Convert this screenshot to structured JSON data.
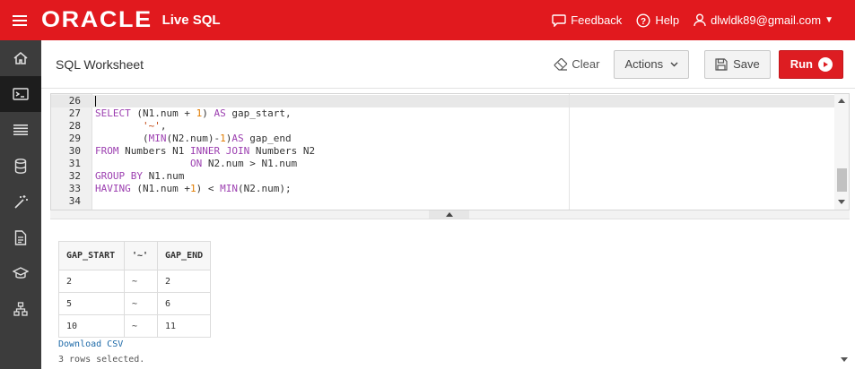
{
  "topbar": {
    "logo": "ORACLE",
    "product": "Live SQL",
    "feedback": "Feedback",
    "help": "Help",
    "user": "dlwldk89@gmail.com"
  },
  "sidenav": {
    "items": [
      {
        "icon": "home-icon",
        "active": false
      },
      {
        "icon": "terminal-icon",
        "active": true
      },
      {
        "icon": "list-icon",
        "active": false
      },
      {
        "icon": "database-icon",
        "active": false
      },
      {
        "icon": "magic-wand-icon",
        "active": false
      },
      {
        "icon": "document-icon",
        "active": false
      },
      {
        "icon": "graduation-cap-icon",
        "active": false
      },
      {
        "icon": "sitemap-icon",
        "active": false
      }
    ]
  },
  "header": {
    "title": "SQL Worksheet",
    "clear": "Clear",
    "actions": "Actions",
    "save": "Save",
    "run": "Run"
  },
  "editor": {
    "line_numbers": [
      "26",
      "27",
      "28",
      "29",
      "30",
      "31",
      "32",
      "33",
      "34"
    ],
    "lines": [
      "",
      "SELECT (N1.num + 1) AS gap_start,",
      "        '~',",
      "        (MIN(N2.num)-1)AS gap_end",
      "FROM Numbers N1 INNER JOIN Numbers N2",
      "                ON N2.num > N1.num",
      "GROUP BY N1.num",
      "HAVING (N1.num +1) < MIN(N2.num);",
      ""
    ]
  },
  "results": {
    "columns": [
      "GAP_START",
      "'~'",
      "GAP_END"
    ],
    "rows": [
      [
        "2",
        "~",
        "2"
      ],
      [
        "5",
        "~",
        "6"
      ],
      [
        "10",
        "~",
        "11"
      ]
    ],
    "download": "Download CSV",
    "summary": "3 rows selected."
  },
  "colors": {
    "brand_red": "#e1191e",
    "sidenav_bg": "#3c3c3c",
    "keyword": "#9c3fb0",
    "number": "#e07b00",
    "string": "#c1440e",
    "link": "#1e6aa8"
  }
}
